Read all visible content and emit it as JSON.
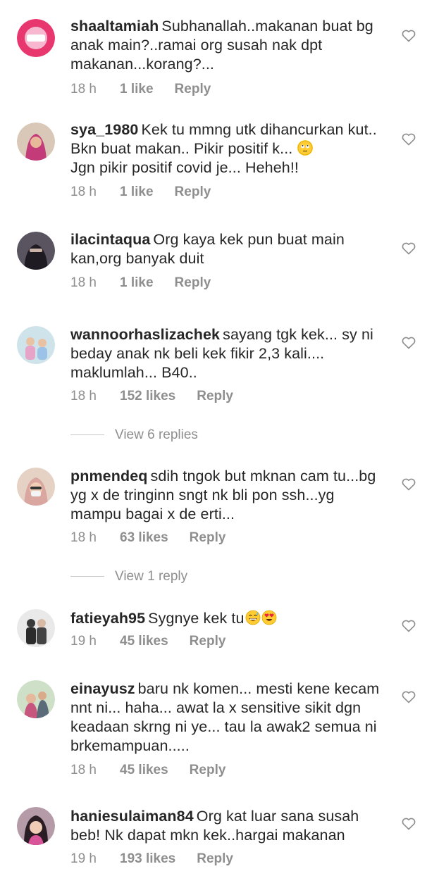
{
  "comments": [
    {
      "user": "shaaltamiah",
      "text": "Subhanallah..makanan buat bg anak main?..ramai org susah nak dpt makanan...korang?...",
      "time": "18 h",
      "likes": "1 like",
      "reply": "Reply"
    },
    {
      "user": "sya_1980",
      "text": "Kek tu mmng utk dihancurkan kut.. Bkn buat makan.. Pikir positif k...",
      "text2": "Jgn pikir positif covid je... Heheh!!",
      "time": "18 h",
      "likes": "1 like",
      "reply": "Reply"
    },
    {
      "user": "ilacintaqua",
      "text": "Org kaya kek pun buat main kan,org banyak duit",
      "time": "18 h",
      "likes": "1 like",
      "reply": "Reply"
    },
    {
      "user": "wannoorhaslizachek",
      "text": "sayang tgk kek... sy ni beday anak nk beli kek fikir 2,3 kali.... maklumlah... B40..",
      "time": "18 h",
      "likes": "152 likes",
      "reply": "Reply"
    },
    {
      "user": "pnmendeq",
      "text": "sdih tngok but mknan cam tu...bg yg x de tringinn sngt nk bli pon ssh...yg mampu bagai x de erti...",
      "time": "18 h",
      "likes": "63 likes",
      "reply": "Reply"
    },
    {
      "user": "fatieyah95",
      "text": "Sygnye kek tu",
      "time": "19 h",
      "likes": "45 likes",
      "reply": "Reply"
    },
    {
      "user": "einayusz",
      "text": "baru nk komen... mesti kene kecam nnt ni... haha... awat la x sensitive sikit dgn keadaan skrng ni ye... tau la awak2 semua ni brkemampuan.....",
      "time": "18 h",
      "likes": "45 likes",
      "reply": "Reply"
    },
    {
      "user": "haniesulaiman84",
      "text": "Org kat luar sana susah beb! Nk dapat mkn kek..hargai makanan",
      "time": "19 h",
      "likes": "193 likes",
      "reply": "Reply"
    }
  ],
  "view_replies": [
    "View 6 replies",
    "View 1 reply"
  ],
  "icons": {
    "like": "heart-outline-icon",
    "emoji": [
      "face-rolling-eyes-emoji",
      "grinning-sweat-emoji",
      "heart-eyes-emoji"
    ]
  },
  "colors": {
    "text": "#262626",
    "meta": "#8e8e8e",
    "background": "#ffffff"
  }
}
